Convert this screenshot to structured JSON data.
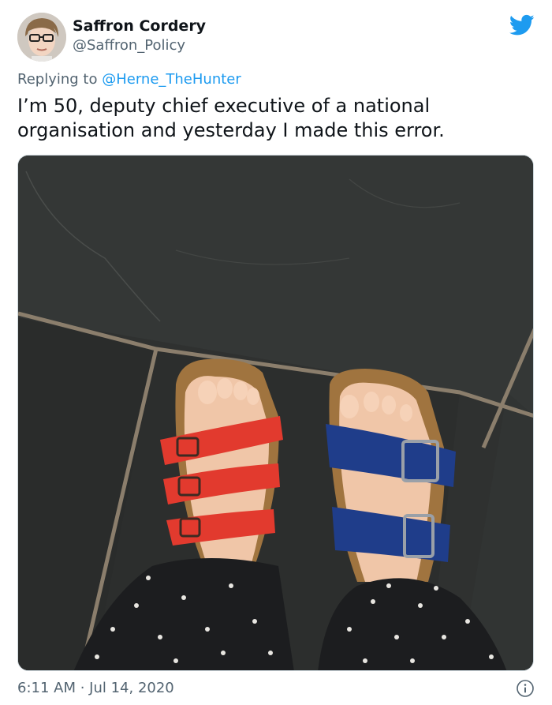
{
  "author": {
    "display_name": "Saffron Cordery",
    "handle": "@Saffron_Policy",
    "avatar_icon": "profile-photo"
  },
  "reply": {
    "prefix": "Replying to",
    "mention": "@Herne_TheHunter"
  },
  "tweet": {
    "text": "I’m 50, deputy chief executive of a national organisation and yesterday I made this error."
  },
  "media": {
    "description_icon": "photo-mismatched-sandals",
    "colors": {
      "left_sandal": "#e23a2e",
      "right_sandal": "#1f3d8a",
      "floor": "#2f3130"
    }
  },
  "meta": {
    "timestamp": "6:11 AM · Jul 14, 2020",
    "info_icon": "info-icon"
  },
  "brand": {
    "twitter_blue": "#1d9bf0",
    "secondary_text": "#536471"
  }
}
